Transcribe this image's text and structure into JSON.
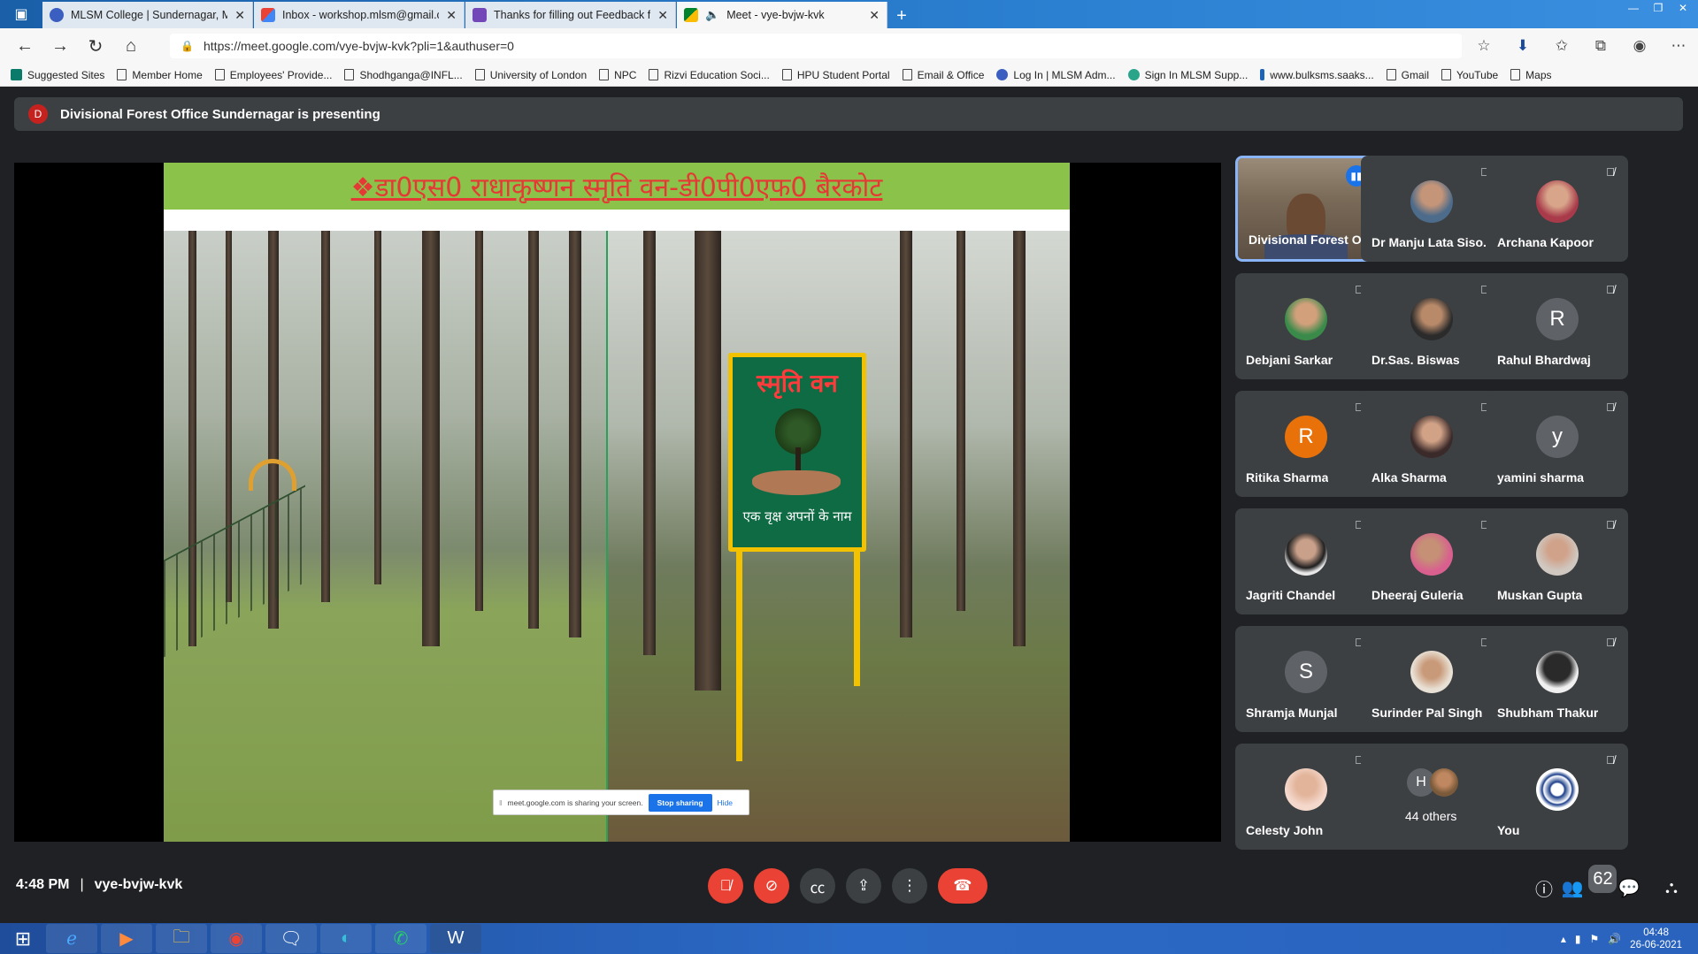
{
  "browser": {
    "tabs": [
      {
        "title": "MLSM College | Sundernagar, M",
        "favicon_color": "#3b5fc0"
      },
      {
        "title": "Inbox - workshop.mlsm@gmail.c",
        "favicon_color": "#ea4335"
      },
      {
        "title": "Thanks for filling out Feedback f",
        "favicon_color": "#7248b9"
      },
      {
        "title": "Meet - vye-bvjw-kvk",
        "favicon_color": "#00832d"
      }
    ],
    "url": "https://meet.google.com/vye-bvjw-kvk?pli=1&authuser=0",
    "bookmarks": [
      "Suggested Sites",
      "Member Home",
      "Employees' Provide...",
      "Shodhganga@INFL...",
      "University of London",
      "NPC",
      "Rizvi Education Soci...",
      "HPU Student Portal",
      "Email & Office",
      "Log In | MLSM Adm...",
      "Sign In MLSM Supp...",
      "www.bulksms.saaks...",
      "Gmail",
      "YouTube",
      "Maps"
    ]
  },
  "meet": {
    "presenter_initial": "D",
    "presenting_banner": "Divisional Forest Office Sundernagar is presenting",
    "slide": {
      "heading": "❖डा0एस0 राधाकृष्णन स्मृति वन-डी0पी0एफ0 बैरकोट",
      "board_title": "स्मृति वन",
      "board_footer": "एक वृक्ष अपनों के नाम"
    },
    "share_popup": {
      "text": "meet.google.com is sharing your screen.",
      "stop": "Stop sharing",
      "hide": "Hide"
    },
    "participants": [
      {
        "name": "Divisional Forest O...",
        "avatar": "photo",
        "speaking": true
      },
      {
        "name": "Dr Manju Lata Siso...",
        "avatar": "photo"
      },
      {
        "name": "Archana Kapoor",
        "avatar": "photo"
      },
      {
        "name": "Debjani Sarkar",
        "avatar": "photo"
      },
      {
        "name": "Dr.Sas. Biswas",
        "avatar": "photo"
      },
      {
        "name": "Rahul Bhardwaj",
        "avatar": "R",
        "color": "#5f6368"
      },
      {
        "name": "Ritika Sharma",
        "avatar": "R",
        "color": "#e8710a"
      },
      {
        "name": "Alka Sharma",
        "avatar": "photo"
      },
      {
        "name": "yamini sharma",
        "avatar": "y",
        "color": "#5f6368"
      },
      {
        "name": "Jagriti Chandel",
        "avatar": "photo"
      },
      {
        "name": "Dheeraj Guleria",
        "avatar": "photo"
      },
      {
        "name": "Muskan Gupta",
        "avatar": "photo"
      },
      {
        "name": "Shramja Munjal",
        "avatar": "S",
        "color": "#5f6368"
      },
      {
        "name": "Surinder Pal Singh",
        "avatar": "photo"
      },
      {
        "name": "Shubham Thakur",
        "avatar": "photo"
      },
      {
        "name": "Celesty John",
        "avatar": "photo"
      },
      {
        "name": "44 others",
        "avatar": "H",
        "color": "#5f6368"
      },
      {
        "name": "You",
        "avatar": "emblem"
      }
    ],
    "time": "4:48 PM",
    "meeting_code": "vye-bvjw-kvk",
    "people_count": "62"
  },
  "taskbar": {
    "time": "04:48",
    "date": "26-06-2021"
  }
}
